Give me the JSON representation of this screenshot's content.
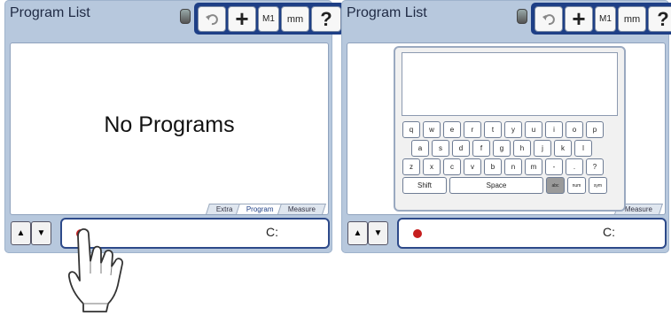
{
  "left_screen": {
    "title": "Program List",
    "toolbar": {
      "m1_label": "M1",
      "mm_label": "mm",
      "help_label": "?"
    },
    "message": "No Programs",
    "tabs": [
      "Extra",
      "Program",
      "Measure"
    ],
    "active_tab": "Program",
    "drive_label": "C:"
  },
  "right_screen": {
    "title": "Program List",
    "toolbar": {
      "m1_label": "M1",
      "mm_label": "mm",
      "help_label": "?"
    },
    "tabs": [
      "Measure"
    ],
    "drive_label": "C:",
    "keyboard": {
      "rows": [
        [
          "q",
          "w",
          "e",
          "r",
          "t",
          "y",
          "u",
          "i",
          "o",
          "p"
        ],
        [
          "a",
          "s",
          "d",
          "f",
          "g",
          "h",
          "j",
          "k",
          "l"
        ],
        [
          "z",
          "x",
          "c",
          "v",
          "b",
          "n",
          "m",
          "-",
          ".",
          "?"
        ]
      ],
      "shift_label": "Shift",
      "space_label": "Space",
      "mode_keys": [
        "abc",
        "num",
        "sym"
      ],
      "active_mode": "abc"
    }
  },
  "colors": {
    "toolbar": "#1e3f86",
    "screen_bg": "#b7c8dd",
    "record_dot": "#c61e1e"
  }
}
